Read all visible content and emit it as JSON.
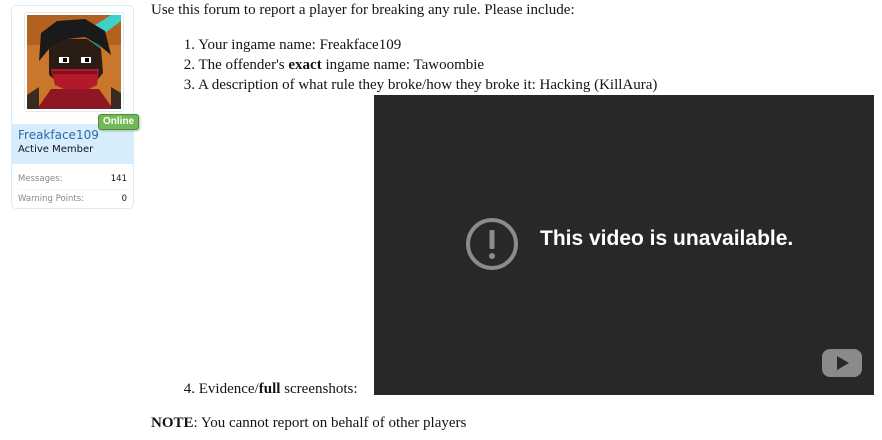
{
  "user": {
    "name": "Freakface109",
    "title": "Active Member",
    "status_badge": "Online",
    "avatar_icon": "user-avatar-icon",
    "stats": [
      {
        "label": "Messages:",
        "value": "141"
      },
      {
        "label": "Warning Points:",
        "value": "0"
      }
    ]
  },
  "post": {
    "intro": "Use this forum to report a player for breaking any rule. Please include:",
    "items": [
      {
        "num": "1.",
        "pre": "Your ingame name: ",
        "bold": "",
        "post": "Freakface109"
      },
      {
        "num": "2.",
        "pre": "The offender's ",
        "bold": "exact",
        "post": " ingame name: Tawoombie"
      },
      {
        "num": "3.",
        "pre": "A description of what rule they broke/how they broke it: Hacking (KillAura)",
        "bold": "",
        "post": ""
      }
    ],
    "evidence": {
      "num": "4.",
      "pre": "Evidence/",
      "bold": "full",
      "post": " screenshots:"
    },
    "note": {
      "bold": "NOTE",
      "text": ": You cannot report on behalf of other players"
    }
  },
  "video": {
    "message": "This video is unavailable.",
    "error_icon": "exclamation-circle-icon",
    "logo_icon": "youtube-play-icon"
  },
  "colors": {
    "username": "#2b6ba8",
    "online_badge": "#72b856",
    "card_border": "#d7edfc",
    "video_bg": "#282828"
  }
}
